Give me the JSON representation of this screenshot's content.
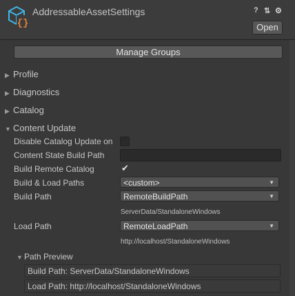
{
  "header": {
    "title": "AddressableAssetSettings",
    "open_label": "Open",
    "help_icon": "help-icon",
    "presets_icon": "presets-icon",
    "settings_icon": "gear-icon",
    "help_glyph": "?",
    "presets_glyph": "⇅",
    "settings_glyph": "⚙"
  },
  "manage_groups_label": "Manage Groups",
  "foldouts": {
    "profile": "Profile",
    "diagnostics": "Diagnostics",
    "catalog": "Catalog",
    "content_update": "Content Update"
  },
  "content_update": {
    "disable_catalog_label": "Disable Catalog Update on",
    "disable_catalog_checked": false,
    "content_state_path_label": "Content State Build Path",
    "content_state_path_value": "",
    "build_remote_catalog_label": "Build Remote Catalog",
    "build_remote_catalog_checked": true,
    "build_load_paths_label": "Build & Load Paths",
    "build_load_paths_value": "<custom>",
    "build_path_label": "Build Path",
    "build_path_value": "RemoteBuildPath",
    "build_path_resolved": "ServerData/StandaloneWindows",
    "load_path_label": "Load Path",
    "load_path_value": "RemoteLoadPath",
    "load_path_resolved": "http://localhost/StandaloneWindows"
  },
  "path_preview": {
    "label": "Path Preview",
    "build_path": "Build Path: ServerData/StandaloneWindows",
    "load_path": "Load Path: http://localhost/StandaloneWindows"
  },
  "colors": {
    "background": "#383838",
    "header": "#3c3c3c",
    "button": "#585858",
    "field": "#2a2a2a",
    "icon_blue": "#3fb7e6",
    "icon_orange": "#e8823a"
  }
}
